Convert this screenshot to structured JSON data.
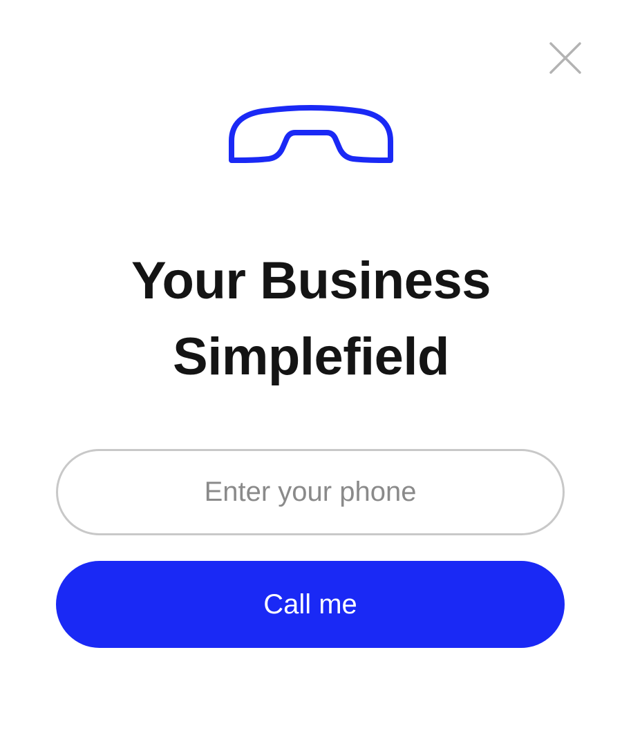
{
  "dialog": {
    "close_icon": "close-icon",
    "phone_icon": "phone-handset-icon",
    "title_line1": "Your Business",
    "title_line2": "Simplefield",
    "phone_placeholder": "Enter your phone",
    "phone_value": "",
    "call_button_label": "Call me"
  },
  "colors": {
    "accent": "#1a29f5",
    "title": "#141414",
    "input_border": "#c8c8c8",
    "placeholder": "#8a8a8a",
    "close_icon": "#b3b3b3"
  }
}
